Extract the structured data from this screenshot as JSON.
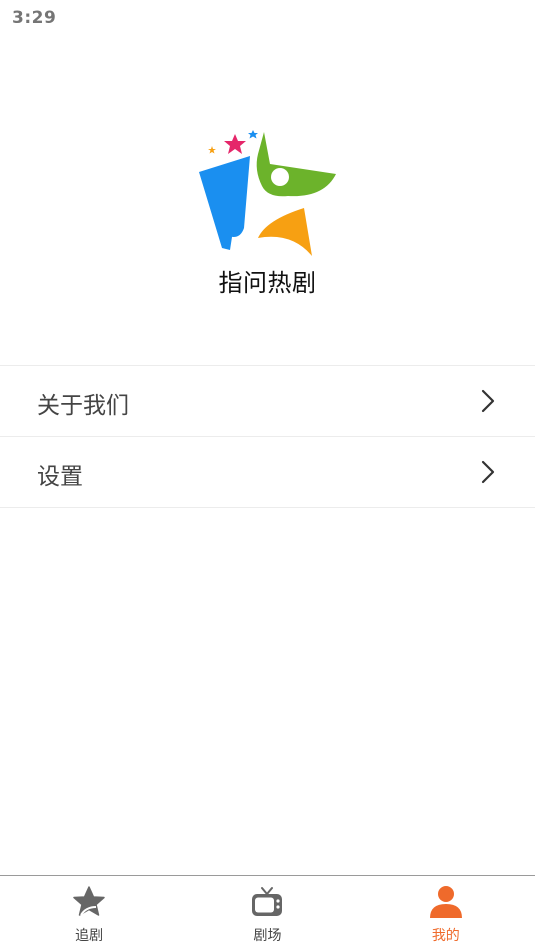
{
  "status_bar": {
    "time": "3:29"
  },
  "app": {
    "name": "指问热剧"
  },
  "menu": {
    "items": [
      {
        "label": "关于我们"
      },
      {
        "label": "设置"
      }
    ]
  },
  "tabs": [
    {
      "label": "追剧",
      "icon": "star-icon",
      "active": false
    },
    {
      "label": "剧场",
      "icon": "tv-icon",
      "active": false
    },
    {
      "label": "我的",
      "icon": "person-icon",
      "active": true
    }
  ],
  "colors": {
    "accent": "#ef6a2b",
    "logo_blue": "#1a8ff0",
    "logo_green": "#6cb32b",
    "logo_orange": "#f7a012",
    "logo_pink": "#e5266a",
    "icon_gray": "#666666"
  }
}
